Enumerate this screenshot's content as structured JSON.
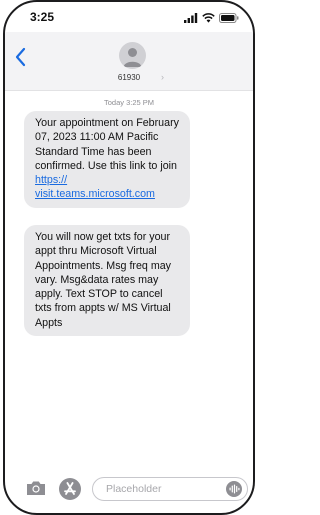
{
  "status_bar": {
    "time": "3:25"
  },
  "header": {
    "sender": "61930",
    "sender_chevron": "›"
  },
  "conversation": {
    "timestamp": "Today 3:25 PM",
    "messages": [
      {
        "text_before_link": "Your appointment on February 07, 2023 11:00 AM Pacific Standard Time has been confirmed. Use this link to join ",
        "link_text": "https://\nvisit.teams.microsoft.com"
      },
      {
        "text": "You will now get txts for your appt thru Microsoft Virtual Appointments. Msg freq may vary. Msg&data rates may apply. Text STOP to cancel txts from appts w/ MS Virtual Appts"
      }
    ]
  },
  "input": {
    "placeholder": "Placeholder"
  },
  "icons": [
    "signal-icon",
    "wifi-icon",
    "battery-icon",
    "back-chevron-icon",
    "contact-avatar-icon",
    "camera-icon",
    "app-store-icon",
    "voice-waveform-icon"
  ],
  "colors": {
    "link": "#1a6be0",
    "back": "#1a6be0",
    "bubble": "#e9e9eb",
    "header_bg": "#f3f3f5"
  }
}
